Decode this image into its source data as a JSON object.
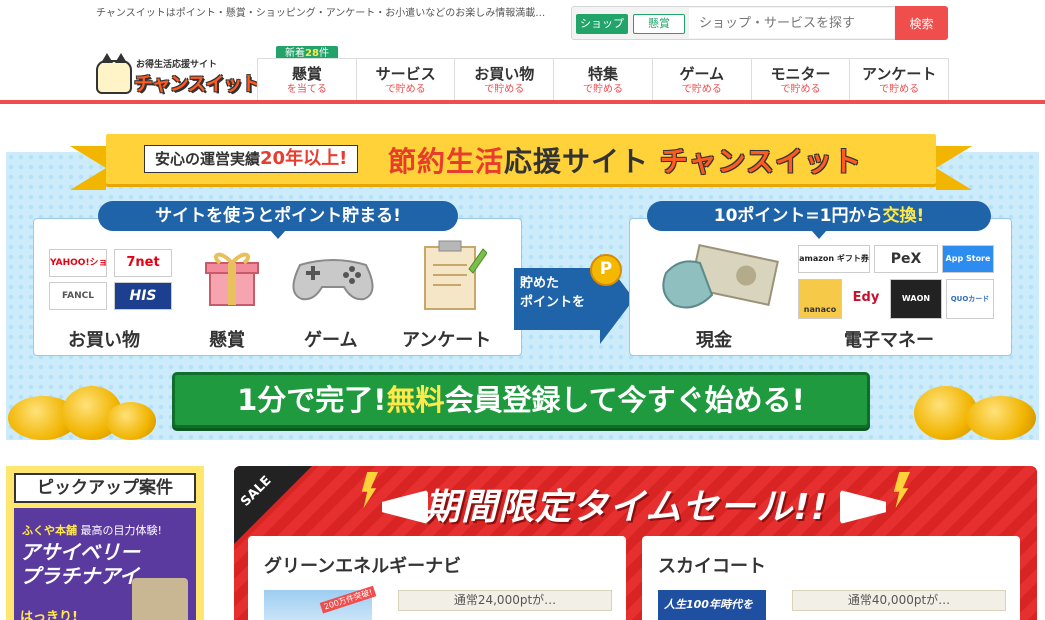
{
  "header": {
    "tagline": "チャンスイットはポイント・懸賞・ショッピング・アンケート・お小遣いなどのお楽しみ情報満載…",
    "logo": {
      "subtitle": "お得生活応援サイト",
      "name": "チャンスイット"
    },
    "search": {
      "tabs": [
        "ショップ",
        "懸賞"
      ],
      "active_tab": "ショップ",
      "placeholder": "ショップ・サービスを探す",
      "button_label": "検索"
    },
    "new_badge": {
      "prefix": "新着",
      "count": "28",
      "suffix": "件"
    },
    "nav": [
      {
        "label": "懸賞",
        "sub": "を当てる"
      },
      {
        "label": "サービス",
        "sub": "で貯める"
      },
      {
        "label": "お買い物",
        "sub": "で貯める"
      },
      {
        "label": "特集",
        "sub": "で貯める"
      },
      {
        "label": "ゲーム",
        "sub": "で貯める"
      },
      {
        "label": "モニター",
        "sub": "で貯める"
      },
      {
        "label": "アンケート",
        "sub": "で貯める"
      }
    ],
    "accent_color": "#f04d4d",
    "brand_green": "#22a36a"
  },
  "hero": {
    "ribbon_box_prefix": "安心の運営実績",
    "ribbon_box_highlight": "20年以上!",
    "ribbon_title_highlight": "節約生活",
    "ribbon_title_rest": "応援サイト",
    "ribbon_logo": "チャンスイット",
    "left_pill": "サイトを使うとポイント貯まる!",
    "right_pill_prefix": "10ポイント=1円から",
    "right_pill_highlight": "交換!",
    "arrow_line1": "貯めた",
    "arrow_line2": "ポイントを",
    "coin_letter": "P",
    "shop_logos": [
      "YAHOO!ショッピング",
      "7net",
      "FANCL",
      "HIS"
    ],
    "categories": [
      "お買い物",
      "懸賞",
      "ゲーム",
      "アンケート"
    ],
    "exchange_logos": [
      "amazon ギフト券",
      "PeX",
      "App Store",
      "nanaco",
      "Edy",
      "WAON",
      "QUOカード"
    ],
    "exchange_labels": [
      "現金",
      "電子マネー"
    ],
    "cta_prefix": "1分で完了!",
    "cta_highlight": "無料",
    "cta_rest": "会員登録して今すぐ始める!"
  },
  "pickup": {
    "title": "ピックアップ案件",
    "card_brand": "ふくや本舗",
    "card_tagline": "最高の目力体験!",
    "card_name_line1": "アサイベリー",
    "card_name_line2": "プラチナアイ",
    "card_footer": "はっきり!"
  },
  "sale": {
    "corner_label": "SALE",
    "title": "期間限定タイムセール!!",
    "cards": [
      {
        "name": "グリーンエネルギーナビ",
        "normal": "通常24,000ptが…",
        "thumb_tag": "200万件突破!",
        "thumb_text": ""
      },
      {
        "name": "スカイコート",
        "normal": "通常40,000ptが…",
        "thumb_tag": "",
        "thumb_text": "人生100年時代を"
      }
    ]
  }
}
